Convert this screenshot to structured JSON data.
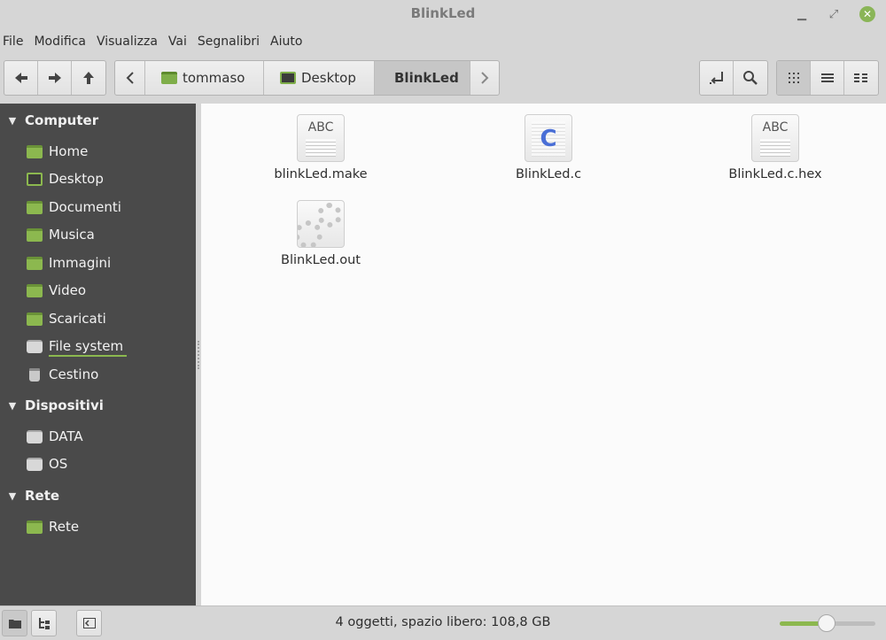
{
  "window": {
    "title": "BlinkLed"
  },
  "window_controls": {
    "minimize": "▁",
    "maximize": "⤢",
    "close": "✕"
  },
  "menubar": [
    "File",
    "Modifica",
    "Visualizza",
    "Vai",
    "Segnalibri",
    "Aiuto"
  ],
  "toolbar": {
    "nav_icons": [
      "arrow-left-icon",
      "arrow-right-icon",
      "arrow-up-icon"
    ],
    "breadcrumb": [
      {
        "label": "tommaso",
        "icon": "home-folder-icon"
      },
      {
        "label": "Desktop",
        "icon": "desktop-folder-icon"
      },
      {
        "label": "BlinkLed",
        "active": true
      }
    ],
    "view_modes": [
      "icon-view",
      "list-view",
      "compact-view"
    ],
    "active_view": "icon-view"
  },
  "sidebar": {
    "sections": [
      {
        "title": "Computer",
        "items": [
          "Home",
          "Desktop",
          "Documenti",
          "Musica",
          "Immagini",
          "Video",
          "Scaricati",
          "File system",
          "Cestino"
        ]
      },
      {
        "title": "Dispositivi",
        "items": [
          "DATA",
          "OS"
        ]
      },
      {
        "title": "Rete",
        "items": [
          "Rete"
        ]
      }
    ],
    "highlighted_item": "File system"
  },
  "files": [
    {
      "name": "blinkLed.make",
      "type": "text",
      "icon_label": "ABC"
    },
    {
      "name": "BlinkLed.c",
      "type": "c-source",
      "icon_label": "C"
    },
    {
      "name": "BlinkLed.c.hex",
      "type": "text",
      "icon_label": "ABC"
    },
    {
      "name": "BlinkLed.out",
      "type": "executable",
      "icon_label": ""
    }
  ],
  "statusbar": {
    "text": "4 oggetti, spazio libero: 108,8 GB",
    "zoom_fraction": 0.5
  },
  "colors": {
    "accent": "#8cb84f",
    "sidebar_bg": "#4a4a4a",
    "main_bg": "#fbfbfb"
  }
}
